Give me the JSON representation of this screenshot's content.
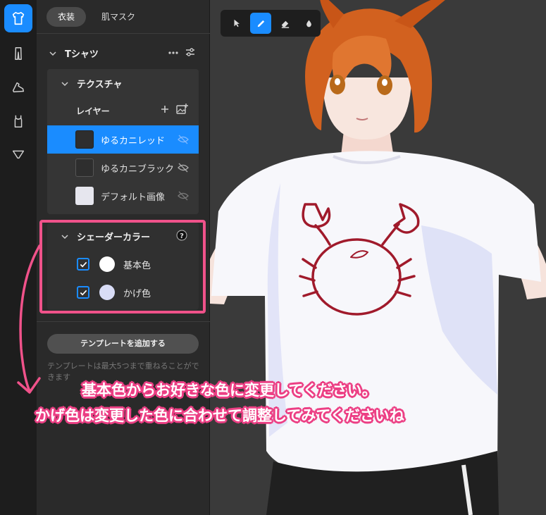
{
  "tabs": [
    {
      "label": "衣装",
      "active": true
    },
    {
      "label": "肌マスク",
      "active": false
    }
  ],
  "item": {
    "title": "Tシャツ",
    "texture_title": "テクスチャ",
    "layer_header": "レイヤー",
    "layers": [
      {
        "name": "ゆるカニレッド",
        "swatch": "#2e2e2e",
        "active": true
      },
      {
        "name": "ゆるカニブラック",
        "swatch": "#2e2e2e",
        "active": false
      },
      {
        "name": "デフォルト画像",
        "swatch": "#e6e6ee",
        "active": false
      }
    ],
    "shader_title": "シェーダーカラー",
    "shader_colors": [
      {
        "label": "基本色",
        "color": "#ffffff",
        "checked": true
      },
      {
        "label": "かげ色",
        "color": "#d8dcf6",
        "checked": true
      }
    ]
  },
  "template_button": "テンプレートを追加する",
  "template_note": "テンプレートは最大5つまで重ねることができます",
  "annotation": {
    "line1": "基本色からお好きな色に変更してください。",
    "line2": "かげ色は変更した色に合わせて調整してみてくださいね",
    "color": "#ec3f84"
  },
  "icons": {
    "rail": [
      "tshirt-icon",
      "pants-icon",
      "shoe-icon",
      "tank-top-icon",
      "underwear-icon"
    ],
    "toolbar": [
      "cursor-icon",
      "pen-icon",
      "eraser-icon",
      "drop-icon"
    ]
  },
  "accent": "#1a8cff"
}
